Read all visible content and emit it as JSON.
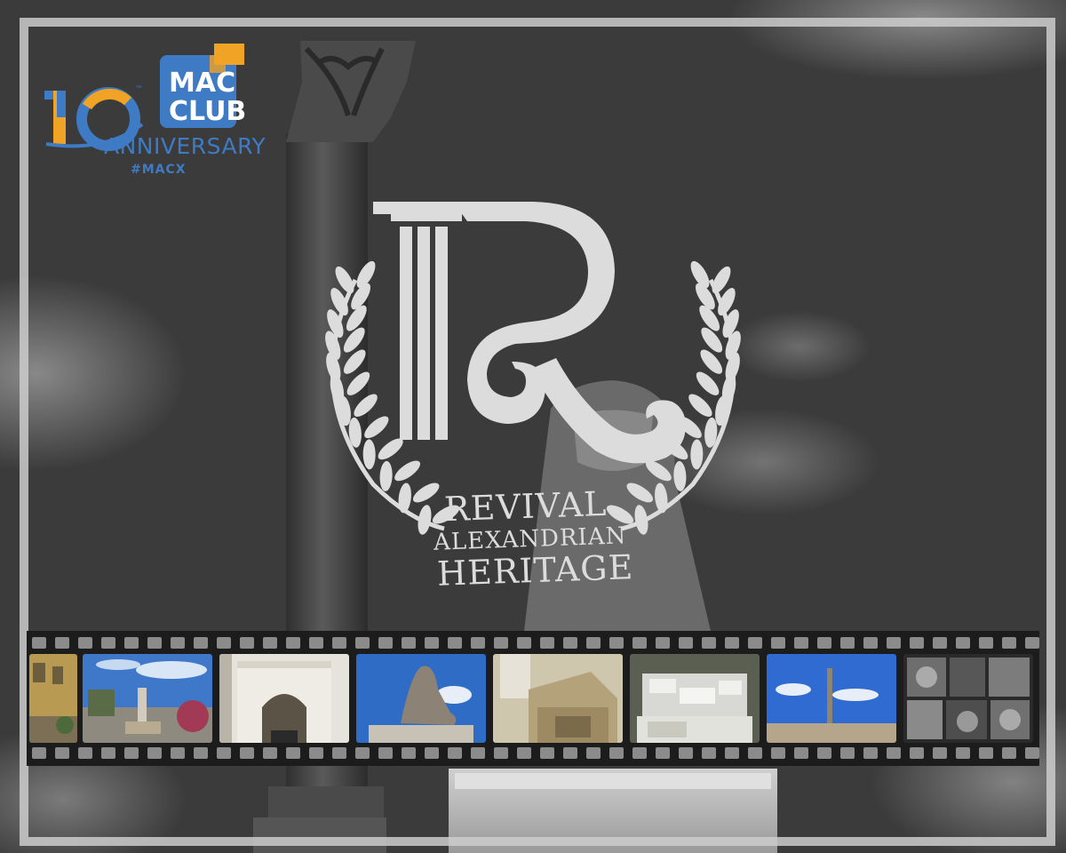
{
  "badge": {
    "number": "10",
    "trademark": "™",
    "line1": "MAC",
    "line2": "CLUB",
    "anniversary": "ANNIVERSARY",
    "hashtag": "#MACX",
    "colors": {
      "blue": "#3e7bc4",
      "orange": "#f0a324"
    }
  },
  "emblem": {
    "monogram": "R",
    "line1": "REVIVAL",
    "line2": "ALEXANDRIAN",
    "line3": "HERITAGE"
  },
  "filmstrip": {
    "photos": [
      {
        "subject": "yellow-building"
      },
      {
        "subject": "garden-monument"
      },
      {
        "subject": "arched-gate"
      },
      {
        "subject": "sphinx"
      },
      {
        "subject": "ornate-tomb"
      },
      {
        "subject": "grave-plaques"
      },
      {
        "subject": "pompeys-pillar"
      },
      {
        "subject": "portraits-collage"
      }
    ]
  }
}
